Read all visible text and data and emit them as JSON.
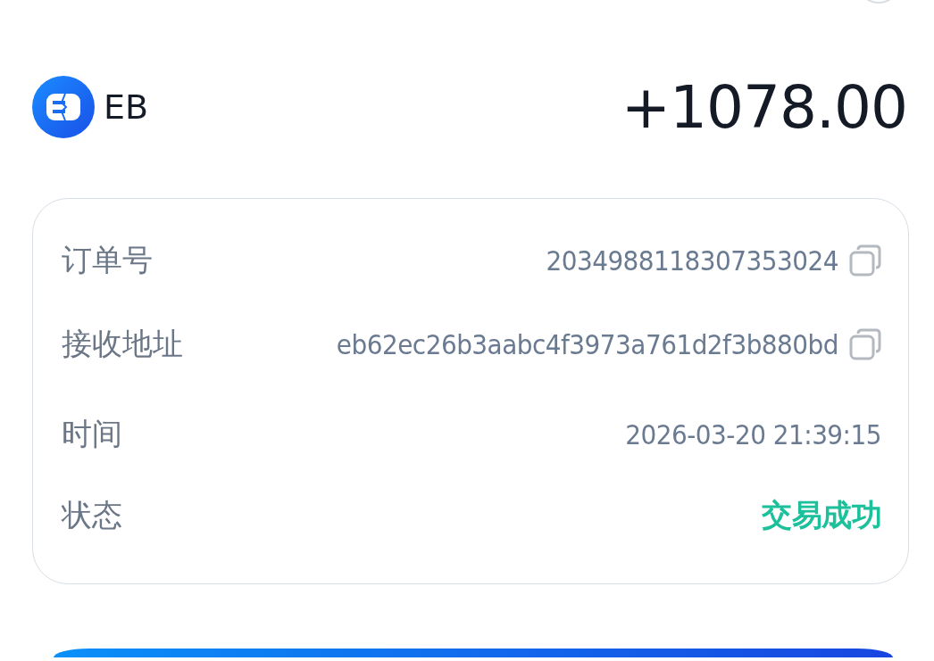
{
  "coin": {
    "symbol": "EB"
  },
  "amount": "+1078.00",
  "details": [
    {
      "label": "订单号",
      "value": "2034988118307353024",
      "kind": "text",
      "copyable": true
    },
    {
      "label": "接收地址",
      "value": "eb62ec26b3aabc4f3973a761d2f3b880bd",
      "kind": "text",
      "copyable": true
    },
    {
      "label": "时间",
      "value": "2026-03-20 21:39:15",
      "kind": "text",
      "copyable": false
    },
    {
      "label": "状态",
      "value": "交易成功",
      "kind": "status",
      "copyable": false
    }
  ]
}
